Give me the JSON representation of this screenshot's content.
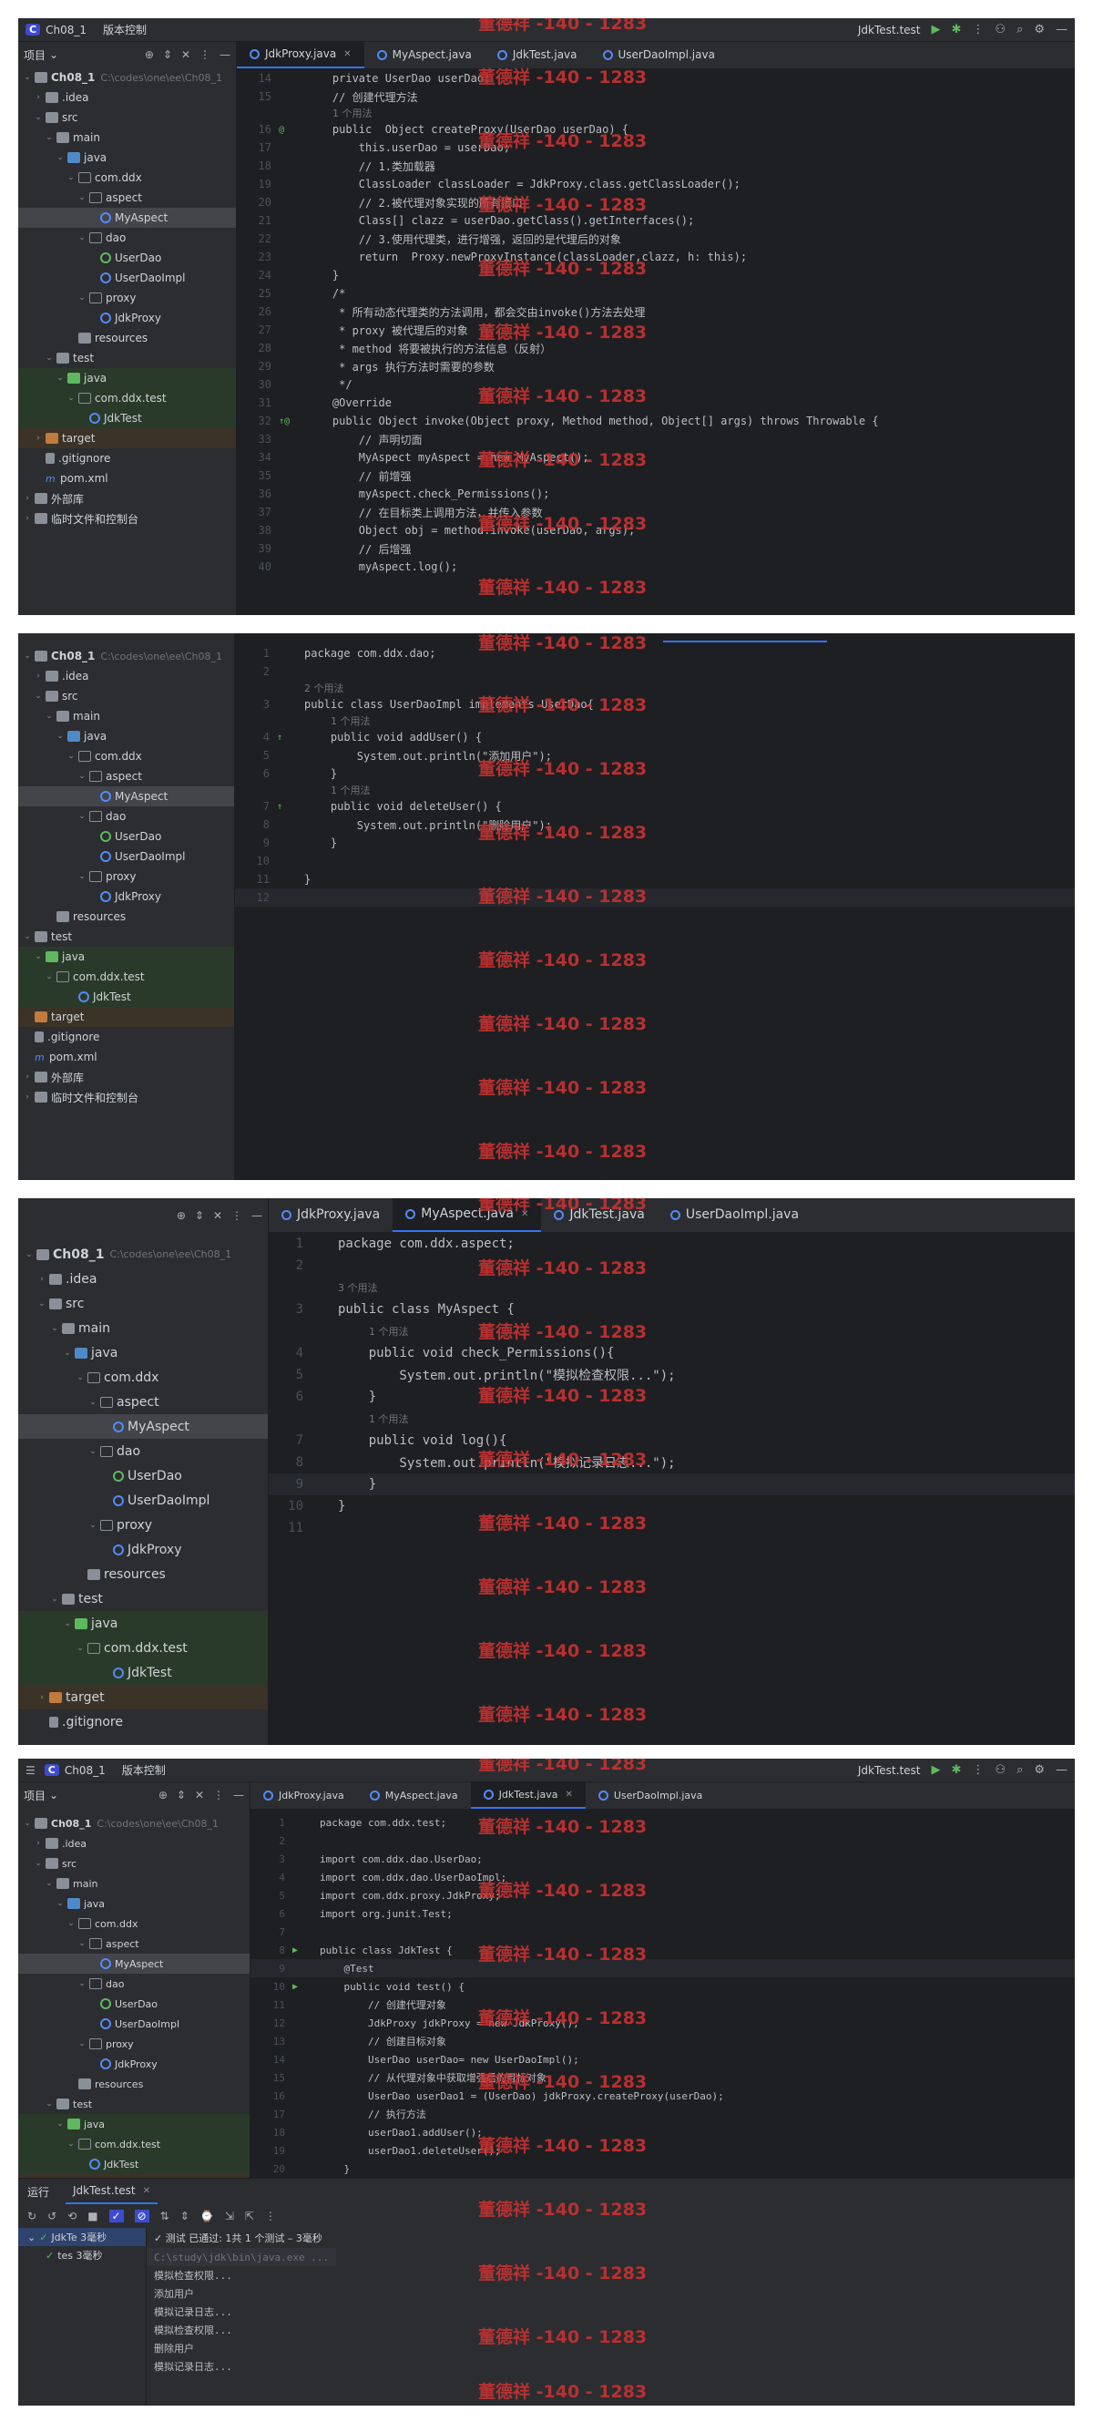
{
  "ide": {
    "project_badge": "C",
    "project_name": "Ch08_1",
    "vcs_label": "版本控制",
    "run_config": "JdkTest.test"
  },
  "sidebar": {
    "title": "项目",
    "root_label": "Ch08_1",
    "root_path": "C:\\codes\\one\\ee\\Ch08_1",
    "items": {
      "idea": ".idea",
      "src": "src",
      "main": "main",
      "java": "java",
      "comddx": "com.ddx",
      "aspect": "aspect",
      "myaspect": "MyAspect",
      "dao": "dao",
      "userdao": "UserDao",
      "userdaoimpl": "UserDaoImpl",
      "proxy": "proxy",
      "jdkproxy": "JdkProxy",
      "resources": "resources",
      "test": "test",
      "testjava": "java",
      "comddxtest": "com.ddx.test",
      "jdktest": "JdkTest",
      "target": "target",
      "gitignore": ".gitignore",
      "pom": "pom.xml",
      "extlibs": "外部库",
      "scratches": "临时文件和控制台"
    }
  },
  "tabs": [
    "JdkProxy.java",
    "MyAspect.java",
    "JdkTest.java",
    "UserDaoImpl.java"
  ],
  "watermark": "董德祥 -140 - 1283",
  "usage_hints": {
    "one": "1 个用法",
    "two": "2 个用法",
    "three": "3 个用法"
  },
  "code1": {
    "l14": "    private UserDao userDao;",
    "l15": "    // 创建代理方法",
    "l16": "    public  Object createProxy(UserDao userDao) {",
    "l17": "        this.userDao = userDao;",
    "l18": "        // 1.类加载器",
    "l19": "        ClassLoader classLoader = JdkProxy.class.getClassLoader();",
    "l20": "        // 2.被代理对象实现的所有接口",
    "l21": "        Class[] clazz = userDao.getClass().getInterfaces();",
    "l22": "        // 3.使用代理类，进行增强，返回的是代理后的对象",
    "l23": "        return  Proxy.newProxyInstance(classLoader,clazz, h: this);",
    "l24": "    }",
    "l25": "    /*",
    "l26": "     * 所有动态代理类的方法调用，都会交由invoke()方法去处理",
    "l27": "     * proxy 被代理后的对象",
    "l28": "     * method 将要被执行的方法信息（反射）",
    "l29": "     * args 执行方法时需要的参数",
    "l30": "     */",
    "l31": "    @Override",
    "l32": "    public Object invoke(Object proxy, Method method, Object[] args) throws Throwable {",
    "l33": "        // 声明切面",
    "l34": "        MyAspect myAspect = new MyAspect();",
    "l35": "        // 前增强",
    "l36": "        myAspect.check_Permissions();",
    "l37": "        // 在目标类上调用方法，并传入参数",
    "l38": "        Object obj = method.invoke(userDao, args);",
    "l39": "        // 后增强",
    "l40": "        myAspect.log();"
  },
  "code2": {
    "l1": "package com.ddx.dao;",
    "l3": "public class UserDaoImpl implements UserDao{",
    "l4": "    public void addUser() {",
    "l5": "        System.out.println(\"添加用户\");",
    "l6": "    }",
    "l7": "    public void deleteUser() {",
    "l8": "        System.out.println(\"删除用户\");",
    "l9": "    }",
    "l11": "}"
  },
  "code3": {
    "l1": "package com.ddx.aspect;",
    "l3": "public class MyAspect {",
    "l4": "    public void check_Permissions(){",
    "l5": "        System.out.println(\"模拟检查权限...\");",
    "l6": "    }",
    "l7": "    public void log(){",
    "l8": "        System.out.println(\"模拟记录日志...\");",
    "l9": "    }",
    "l10": "}"
  },
  "code4": {
    "l1": "package com.ddx.test;",
    "l3": "import com.ddx.dao.UserDao;",
    "l4": "import com.ddx.dao.UserDaoImpl;",
    "l5": "import com.ddx.proxy.JdkProxy;",
    "l6": "import org.junit.Test;",
    "l8": "public class JdkTest {",
    "l9": "    @Test",
    "l10": "    public void test() {",
    "l11": "        // 创建代理对象",
    "l12": "        JdkProxy jdkProxy = new JdkProxy();",
    "l13": "        // 创建目标对象",
    "l14": "        UserDao userDao= new UserDaoImpl();",
    "l15": "        // 从代理对象中获取增强后的目标对象",
    "l16": "        UserDao userDao1 = (UserDao) jdkProxy.createProxy(userDao);",
    "l17": "        // 执行方法",
    "l18": "        userDao1.addUser();",
    "l19": "        userDao1.deleteUser();",
    "l20": "    }",
    "l21": "}"
  },
  "run": {
    "title": "运行",
    "tab": "JdkTest.test",
    "tree_root": "JdkTe 3毫秒",
    "tree_child": "tes 3毫秒",
    "status": "✓ 测试 已通过: 1共 1 个测试 – 3毫秒",
    "cmd": "C:\\study\\jdk\\bin\\java.exe ...",
    "out1": "模拟检查权限...",
    "out2": "添加用户",
    "out3": "模拟记录日志...",
    "out4": "模拟检查权限...",
    "out5": "删除用户",
    "out6": "模拟记录日志..."
  }
}
